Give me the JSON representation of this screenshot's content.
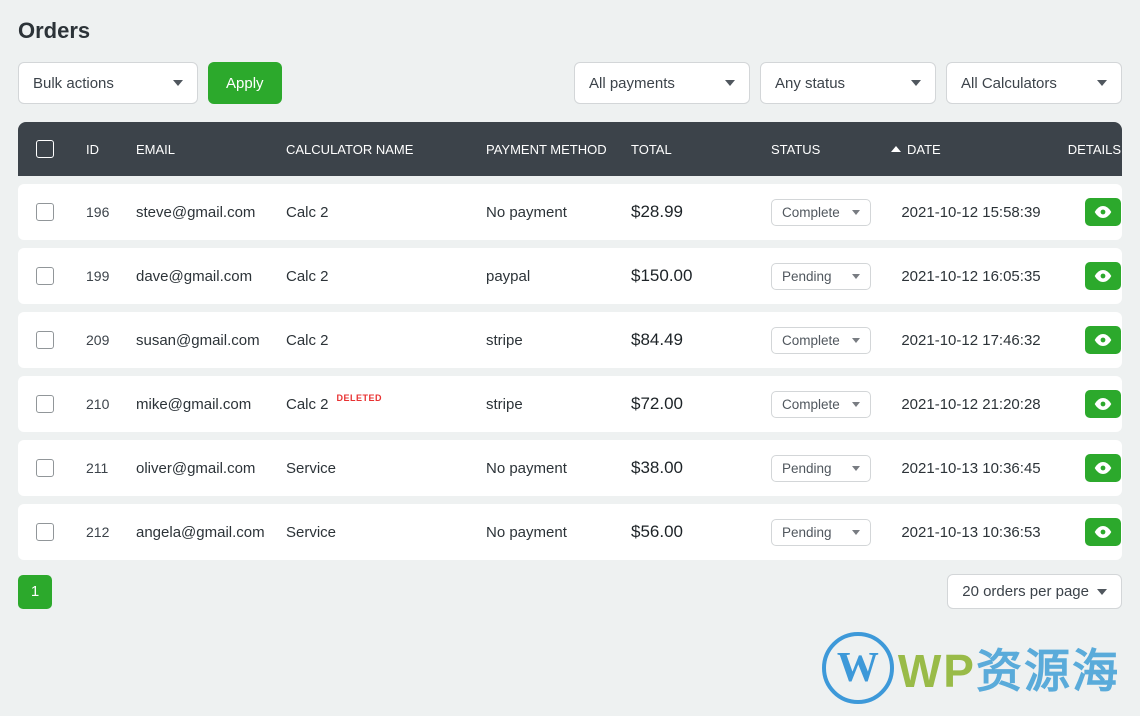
{
  "title": "Orders",
  "toolbar": {
    "bulk_actions": "Bulk actions",
    "apply": "Apply",
    "filter_payments": "All payments",
    "filter_status": "Any status",
    "filter_calculators": "All Calculators"
  },
  "columns": {
    "id": "ID",
    "email": "EMAIL",
    "calculator": "CALCULATOR NAME",
    "payment": "PAYMENT METHOD",
    "total": "TOTAL",
    "status": "STATUS",
    "date": "DATE",
    "details": "DETAILS"
  },
  "status_options": {
    "complete": "Complete",
    "pending": "Pending"
  },
  "deleted_label": "DELETED",
  "rows": [
    {
      "id": "196",
      "email": "steve@gmail.com",
      "calc": "Calc 2",
      "deleted": false,
      "payment": "No payment",
      "total": "$28.99",
      "status": "Complete",
      "date": "2021-10-12 15:58:39"
    },
    {
      "id": "199",
      "email": "dave@gmail.com",
      "calc": "Calc 2",
      "deleted": false,
      "payment": "paypal",
      "total": "$150.00",
      "status": "Pending",
      "date": "2021-10-12 16:05:35"
    },
    {
      "id": "209",
      "email": "susan@gmail.com",
      "calc": "Calc 2",
      "deleted": false,
      "payment": "stripe",
      "total": "$84.49",
      "status": "Complete",
      "date": "2021-10-12 17:46:32"
    },
    {
      "id": "210",
      "email": "mike@gmail.com",
      "calc": "Calc 2",
      "deleted": true,
      "payment": "stripe",
      "total": "$72.00",
      "status": "Complete",
      "date": "2021-10-12 21:20:28"
    },
    {
      "id": "211",
      "email": "oliver@gmail.com",
      "calc": "Service",
      "deleted": false,
      "payment": "No payment",
      "total": "$38.00",
      "status": "Pending",
      "date": "2021-10-13 10:36:45"
    },
    {
      "id": "212",
      "email": "angela@gmail.com",
      "calc": "Service",
      "deleted": false,
      "payment": "No payment",
      "total": "$56.00",
      "status": "Pending",
      "date": "2021-10-13 10:36:53"
    }
  ],
  "pagination": {
    "current": "1",
    "per_page": "20 orders per page"
  },
  "watermark": {
    "wp": "WP",
    "cn": "资源海"
  }
}
